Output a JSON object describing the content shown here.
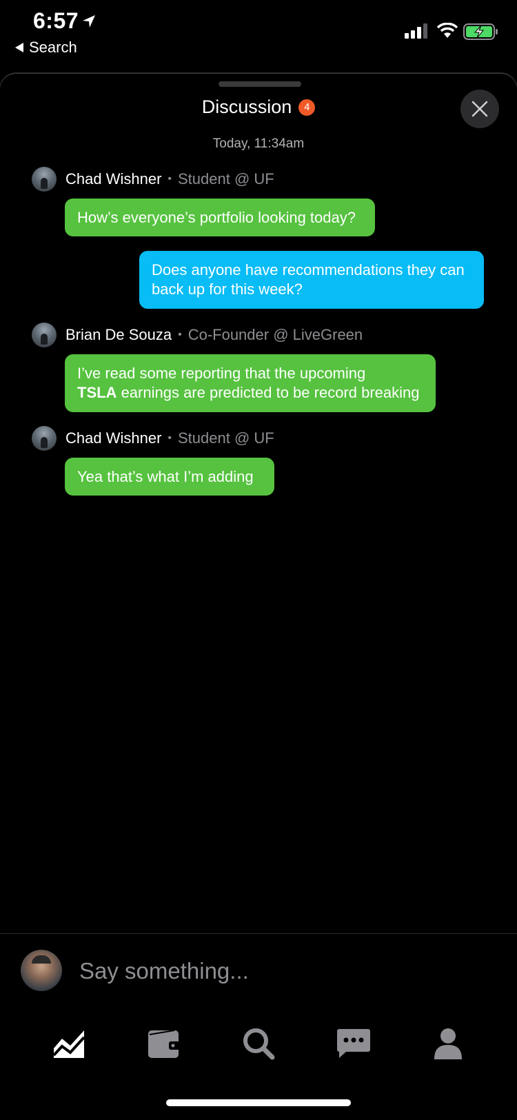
{
  "status_bar": {
    "time": "6:57",
    "back_label": "Search"
  },
  "header": {
    "title": "Discussion",
    "badge_count": "4",
    "timestamp": "Today, 11:34am"
  },
  "messages": [
    {
      "sender_name": "Chad Wishner",
      "sender_role": "Student @ UF",
      "text": "How’s everyone’s portfolio looking today?"
    },
    {
      "text": "Does anyone have recommendations they can back up for this week?",
      "line1": "Does anyone have recommendations they can",
      "line2": "back up for this week?"
    },
    {
      "sender_name": "Brian De Souza",
      "sender_role": "Co-Founder @ LiveGreen",
      "line1": "I’ve read some reporting that the upcoming",
      "ticker": "TSLA",
      "line2_rest": " earnings are predicted to be record breaking"
    },
    {
      "sender_name": "Chad Wishner",
      "sender_role": "Student @ UF",
      "text": "Yea that’s what I’m adding"
    }
  ],
  "composer": {
    "placeholder": "Say something..."
  },
  "tabs": [
    {
      "icon": "chart-icon",
      "active": true
    },
    {
      "icon": "wallet-icon",
      "active": false
    },
    {
      "icon": "search-icon",
      "active": false
    },
    {
      "icon": "chat-icon",
      "active": false
    },
    {
      "icon": "profile-icon",
      "active": false
    }
  ],
  "colors": {
    "green_bubble": "#56c23f",
    "blue_bubble": "#08bcf6",
    "badge": "#f05a28"
  }
}
